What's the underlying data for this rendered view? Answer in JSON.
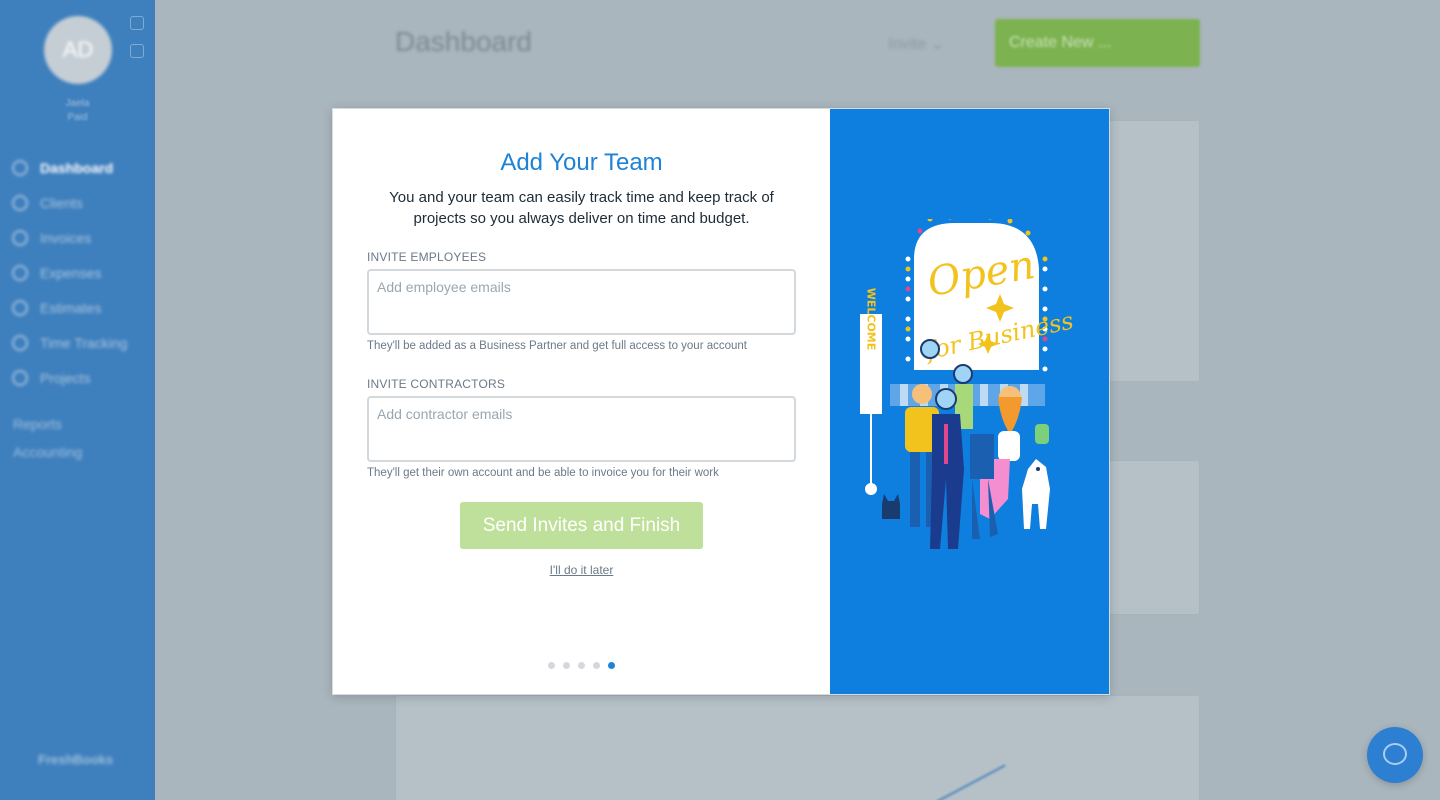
{
  "background": {
    "sidebar": {
      "avatar_initials": "AD",
      "user_line1": "Jaela",
      "user_line2": "Paid",
      "nav": [
        {
          "label": "Dashboard",
          "icon": "dashboard-icon",
          "active": true
        },
        {
          "label": "Clients",
          "icon": "clients-icon"
        },
        {
          "label": "Invoices",
          "icon": "invoices-icon"
        },
        {
          "label": "Expenses",
          "icon": "expenses-icon"
        },
        {
          "label": "Estimates",
          "icon": "estimates-icon"
        },
        {
          "label": "Time Tracking",
          "icon": "clock-icon"
        },
        {
          "label": "Projects",
          "icon": "projects-icon"
        }
      ],
      "reports": "Reports",
      "accounting": "Accounting",
      "logo": "FreshBooks"
    },
    "header": {
      "title": "Dashboard",
      "invite_label": "Invite",
      "create_label": "Create New ..."
    }
  },
  "modal": {
    "title": "Add Your Team",
    "subtitle": "You and your team can easily track time and keep track of projects so you always deliver on time and budget.",
    "employees": {
      "label": "INVITE EMPLOYEES",
      "placeholder": "Add employee emails",
      "value": "",
      "help": "They'll be added as a Business Partner and get full access to your account"
    },
    "contractors": {
      "label": "INVITE CONTRACTORS",
      "placeholder": "Add contractor emails",
      "value": "",
      "help": "They'll get their own account and be able to invoice you for their work"
    },
    "send_button": "Send Invites and Finish",
    "later_link": "I'll do it later",
    "steps": {
      "total": 5,
      "current": 5
    },
    "illustration": {
      "sign_text": "Open for Business",
      "welcome_text": "WELCOME"
    }
  },
  "colors": {
    "accent_blue": "#1e82d6",
    "panel_blue": "#0e7fdf",
    "button_green_disabled": "#bfe09a",
    "sign_yellow": "#f2c31d"
  }
}
